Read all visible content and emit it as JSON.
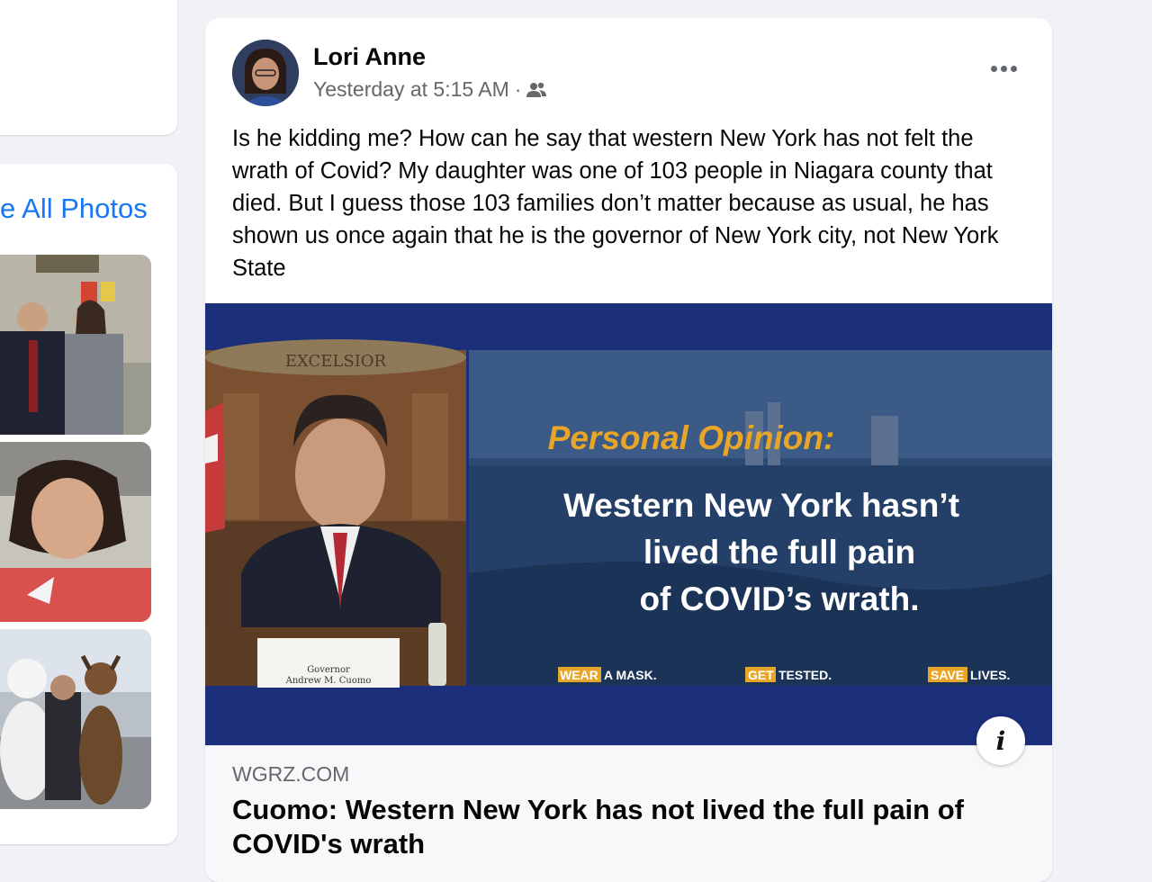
{
  "sidebar": {
    "see_all_photos": "e All Photos"
  },
  "post": {
    "author": "Lori Anne",
    "timestamp": "Yesterday at 5:15 AM",
    "separator": "·",
    "audience_icon": "friends-icon",
    "text": "Is he kidding me? How can he say that western New York has not felt the wrath of Covid? My daughter was one of 103 people in Niagara county that died. But I guess those 103 families don’t matter because as usual, he has shown us once again that he is the governor of New York city, not New York State",
    "media": {
      "seal_text": "EXCELSIOR",
      "placard": [
        "Governor",
        "Andrew M. Cuomo"
      ],
      "opinion_label": "Personal Opinion:",
      "quote_lines": [
        "Western New York hasn’t",
        "lived the full pain",
        "of COVID’s wrath."
      ],
      "slogans": [
        {
          "tag": "WEAR",
          "rest": "A MASK."
        },
        {
          "tag": "GET",
          "rest": "TESTED."
        },
        {
          "tag": "SAVE",
          "rest": "LIVES."
        }
      ]
    },
    "link": {
      "domain": "WGRZ.COM",
      "headline": "Cuomo: Western New York has not lived the full pain of COVID's wrath"
    }
  },
  "colors": {
    "brand_blue": "#1877f2",
    "media_banner": "#1b2f7a",
    "opinion_gold": "#e8a628"
  }
}
